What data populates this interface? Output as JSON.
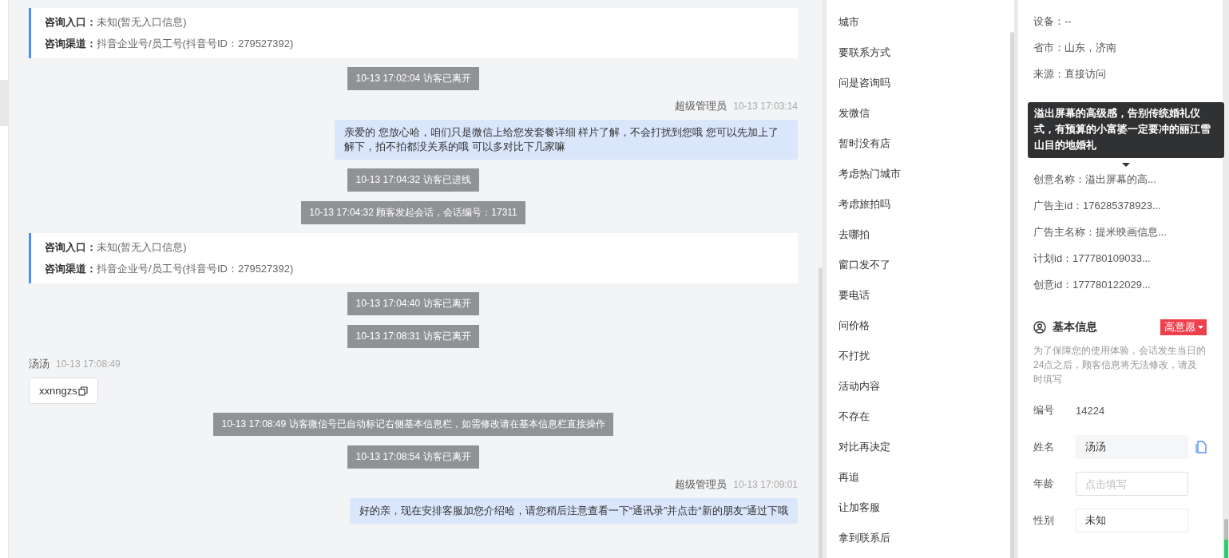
{
  "chat": {
    "items": [
      {
        "kind": "info_card",
        "fields": [
          {
            "label": "咨询入口：",
            "value": "未知(暂无入口信息)"
          },
          {
            "label": "咨询渠道：",
            "value": "抖音企业号/员工号(抖音号ID：279527392)"
          }
        ]
      },
      {
        "kind": "system",
        "text": "10-13 17:02:04 访客已离开"
      },
      {
        "kind": "agent_message",
        "sender": "超级管理员",
        "time": "10-13 17:03:14",
        "text": "亲爱的 您放心哈，咱们只是微信上给您发套餐详细 样片了解，不会打扰到您哦 您可以先加上了解下，拍不拍都没关系的哦 可以多对比下几家嘛"
      },
      {
        "kind": "system",
        "text": "10-13 17:04:32 访客已进线"
      },
      {
        "kind": "system",
        "text": "10-13 17:04:32 顾客发起会话，会话编号：17311"
      },
      {
        "kind": "info_card",
        "fields": [
          {
            "label": "咨询入口：",
            "value": "未知(暂无入口信息)"
          },
          {
            "label": "咨询渠道：",
            "value": "抖音企业号/员工号(抖音号ID：279527392)"
          }
        ]
      },
      {
        "kind": "system",
        "text": "10-13 17:04:40 访客已离开"
      },
      {
        "kind": "system",
        "text": "10-13 17:08:31 访客已离开"
      },
      {
        "kind": "visitor_message",
        "sender": "汤汤",
        "time": "10-13 17:08:49",
        "text": "xxnngzs"
      },
      {
        "kind": "system",
        "text": "10-13 17:08:49 访客微信号已自动标记右侧基本信息栏，如需修改请在基本信息栏直接操作"
      },
      {
        "kind": "system",
        "text": "10-13 17:08:54 访客已离开"
      },
      {
        "kind": "agent_message",
        "sender": "超级管理员",
        "time": "10-13 17:09:01",
        "text": "好的亲，现在安排客服加您介绍哈，请您稍后注意查看一下“通讯录”并点击“新的朋友”通过下哦"
      }
    ]
  },
  "quick_replies": [
    "城市",
    "要联系方式",
    "问是咨询吗",
    "发微信",
    "暂时没有店",
    "考虑热门城市",
    "考虑旅拍吗",
    "去哪拍",
    "窗口发不了",
    "要电话",
    "问价格",
    "不打扰",
    "活动内容",
    "不存在",
    "对比再决定",
    "再追",
    "让加客服",
    "拿到联系后"
  ],
  "visitor_info": {
    "rows_top": [
      "设备：--",
      "省市：山东，济南",
      "来源：直接访问"
    ],
    "tooltip": "溢出屏幕的高级感，告别传统婚礼仪式，有预算的小富婆一定要冲的丽江雪山目的地婚礼",
    "rows_bottom": [
      "创意名称：溢出屏幕的高...",
      "广告主id：176285378923...",
      "广告主名称：提米映画信息...",
      "计划id：177780109033...",
      "创意id：177780122029..."
    ]
  },
  "basic_info": {
    "title": "基本信息",
    "intent_tag": "高意愿",
    "note": "为了保障您的使用体验，会话发生当日的24点之后，顾客信息将无法修改，请及时填写",
    "fields": [
      {
        "kind": "text",
        "label": "编号",
        "value": "14224"
      },
      {
        "kind": "copyable",
        "label": "姓名",
        "value": "汤汤"
      },
      {
        "kind": "input",
        "label": "年龄",
        "placeholder": "点击填写"
      },
      {
        "kind": "select",
        "label": "性别",
        "value": "未知"
      }
    ]
  }
}
